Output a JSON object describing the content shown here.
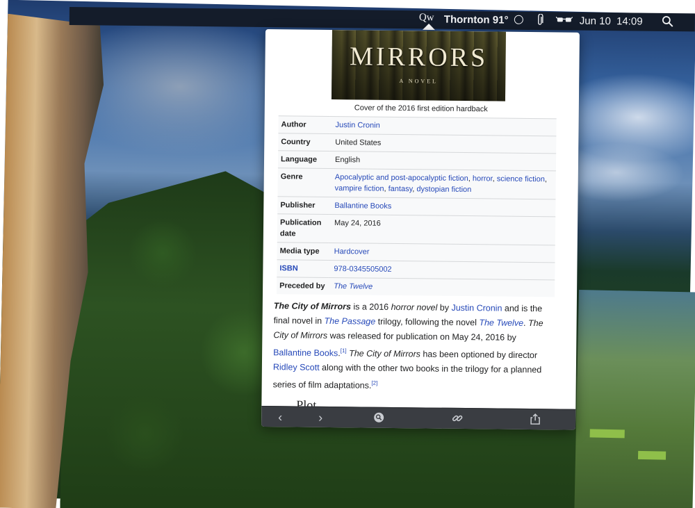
{
  "menubar": {
    "app_icon_label": "Qw",
    "weather": "Thornton 91°",
    "date": "Jun 10",
    "time": "14:09",
    "icons": [
      "circle-icon",
      "paperclip-icon",
      "glasses-icon",
      "search-icon"
    ]
  },
  "article": {
    "cover": {
      "title": "MIRRORS",
      "subtitle": "A NOVEL"
    },
    "caption": "Cover of the 2016 first edition hardback",
    "infobox": {
      "author_label": "Author",
      "author_value": "Justin Cronin",
      "country_label": "Country",
      "country_value": "United States",
      "language_label": "Language",
      "language_value": "English",
      "genre_label": "Genre",
      "genre_1": "Apocalyptic and post-apocalyptic fiction",
      "genre_2": "horror",
      "genre_3": "science fiction",
      "genre_4": "vampire fiction",
      "genre_5": "fantasy",
      "genre_6": "dystopian fiction",
      "publisher_label": "Publisher",
      "publisher_value": "Ballantine Books",
      "pubdate_label": "Publication date",
      "pubdate_value": "May 24, 2016",
      "media_label": "Media type",
      "media_value": "Hardcover",
      "isbn_label": "ISBN",
      "isbn_value": "978-0345505002",
      "preceded_label": "Preceded by",
      "preceded_value": "The Twelve"
    },
    "paragraph": {
      "title": "The City of Mirrors",
      "t1": " is a 2016 ",
      "t2": "horror novel",
      "t3": " by ",
      "author_link": "Justin Cronin",
      "t4": " and is the final novel in ",
      "trilogy_link": "The Passage",
      "t5": " trilogy, following the novel ",
      "novel_link": "The Twelve",
      "t6": ". ",
      "title2": "The City of Mirrors",
      "t7": " was released for publication on May 24, 2016 by ",
      "publisher_link": "Ballantine Books",
      "t8": ".",
      "ref1": "[1]",
      "t9": " ",
      "title3": "The City of Mirrors",
      "t10": " has been optioned by director ",
      "director_link": "Ridley Scott",
      "t11": " along with the other two books in the trilogy for a planned series of film adaptations.",
      "ref2": "[2]"
    },
    "next_heading": "Plot"
  },
  "toolbar": {
    "back_glyph": "‹",
    "forward_glyph": "›"
  },
  "colors": {
    "link": "#2548b8",
    "menubar_bg": "#141c2a",
    "toolbar_bg": "#3a3d42"
  }
}
